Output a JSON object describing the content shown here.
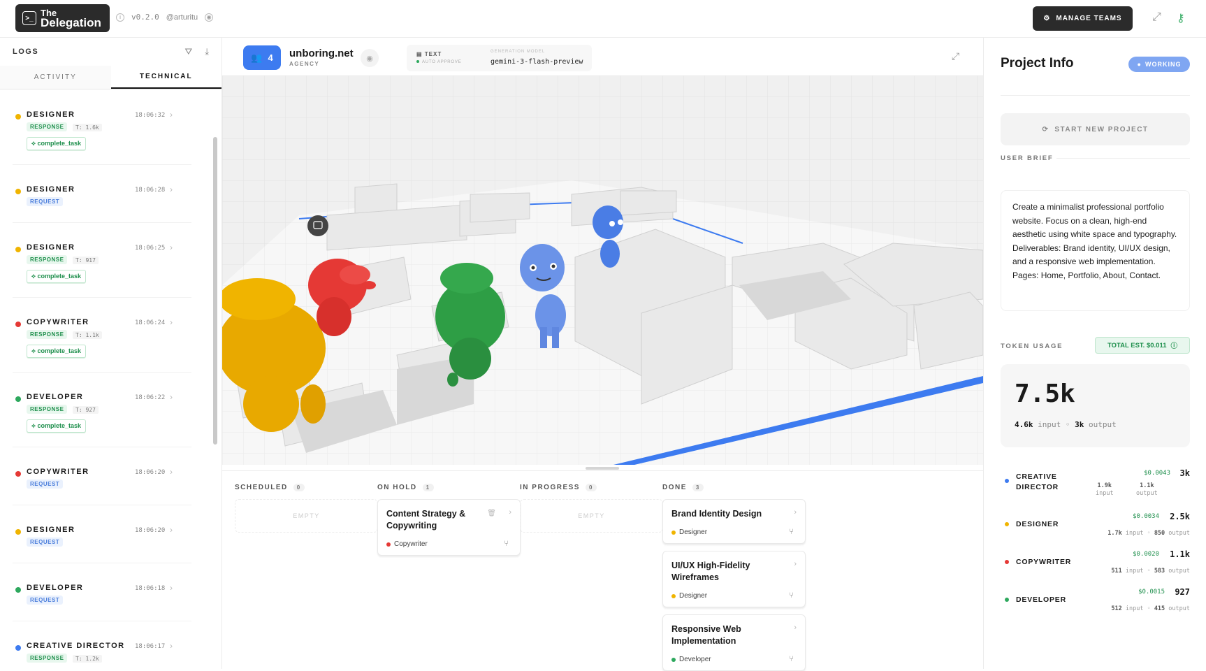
{
  "app": {
    "logo_line1": "The",
    "logo_line2": "Delegation",
    "version": "v0.2.0",
    "author": "@arturitu",
    "manage_teams": "MANAGE TEAMS"
  },
  "logs": {
    "title": "LOGS",
    "tabs": [
      "ACTIVITY",
      "TECHNICAL"
    ],
    "active_tab": "TECHNICAL",
    "items": [
      {
        "role": "DESIGNER",
        "time": "18:06:32",
        "type": "RESPONSE",
        "tokens": "T: 1.6k",
        "tool": "complete_task",
        "color": "#f0b400"
      },
      {
        "role": "DESIGNER",
        "time": "18:06:28",
        "type": "REQUEST",
        "tokens": "",
        "tool": "",
        "color": "#f0b400"
      },
      {
        "role": "DESIGNER",
        "time": "18:06:25",
        "type": "RESPONSE",
        "tokens": "T: 917",
        "tool": "complete_task",
        "color": "#f0b400"
      },
      {
        "role": "COPYWRITER",
        "time": "18:06:24",
        "type": "RESPONSE",
        "tokens": "T: 1.1k",
        "tool": "complete_task",
        "color": "#e53935"
      },
      {
        "role": "DEVELOPER",
        "time": "18:06:22",
        "type": "RESPONSE",
        "tokens": "T: 927",
        "tool": "complete_task",
        "color": "#2da85d"
      },
      {
        "role": "COPYWRITER",
        "time": "18:06:20",
        "type": "REQUEST",
        "tokens": "",
        "tool": "",
        "color": "#e53935"
      },
      {
        "role": "DESIGNER",
        "time": "18:06:20",
        "type": "REQUEST",
        "tokens": "",
        "tool": "",
        "color": "#f0b400"
      },
      {
        "role": "DEVELOPER",
        "time": "18:06:18",
        "type": "REQUEST",
        "tokens": "",
        "tool": "",
        "color": "#2da85d"
      },
      {
        "role": "CREATIVE DIRECTOR",
        "time": "18:06:17",
        "type": "RESPONSE",
        "tokens": "T: 1.2k",
        "tool": "",
        "color": "#3d7bf0"
      }
    ]
  },
  "project": {
    "agent_count": "4",
    "name": "unboring.net",
    "kind": "AGENCY",
    "mode": "TEXT",
    "mode_sub": "AUTO APPROVE",
    "gen_label": "GENERATION MODEL",
    "gen_model": "gemini-3-flash-preview"
  },
  "kanban": {
    "columns": [
      {
        "title": "SCHEDULED",
        "count": "0",
        "empty": "EMPTY",
        "cards": []
      },
      {
        "title": "ON HOLD",
        "count": "1",
        "empty": "",
        "cards": [
          {
            "title": "Content Strategy & Copywriting",
            "assignee": "Copywriter",
            "color": "#e53935"
          }
        ]
      },
      {
        "title": "IN PROGRESS",
        "count": "0",
        "empty": "EMPTY",
        "cards": []
      },
      {
        "title": "DONE",
        "count": "3",
        "empty": "",
        "cards": [
          {
            "title": "Brand Identity Design",
            "assignee": "Designer",
            "color": "#f0b400"
          },
          {
            "title": "UI/UX High-Fidelity Wireframes",
            "assignee": "Designer",
            "color": "#f0b400"
          },
          {
            "title": "Responsive Web Implementation",
            "assignee": "Developer",
            "color": "#2da85d"
          }
        ]
      }
    ]
  },
  "info": {
    "title": "Project Info",
    "status": "WORKING",
    "start_new": "START NEW PROJECT",
    "brief_label": "USER BRIEF",
    "brief": "Create a minimalist professional portfolio website. Focus on a clean, high-end aesthetic using white space and typography. Deliverables: Brand identity, UI/UX design, and a responsive web implementation. Pages: Home, Portfolio, About, Contact.",
    "token_label": "TOKEN USAGE",
    "total_est": "TOTAL EST. $0.011",
    "total_tokens": "7.5k",
    "input_tokens": "4.6k",
    "input_word": "input",
    "output_tokens": "3k",
    "output_word": "output",
    "roles": [
      {
        "name": "CREATIVE DIRECTOR",
        "cost": "$0.0043",
        "total": "3k",
        "input": "1.9k",
        "output": "1.1k",
        "color": "#3d7bf0"
      },
      {
        "name": "DESIGNER",
        "cost": "$0.0034",
        "total": "2.5k",
        "input": "1.7k",
        "output": "850",
        "color": "#f0b400"
      },
      {
        "name": "COPYWRITER",
        "cost": "$0.0020",
        "total": "1.1k",
        "input": "511",
        "output": "583",
        "color": "#e53935"
      },
      {
        "name": "DEVELOPER",
        "cost": "$0.0015",
        "total": "927",
        "input": "512",
        "output": "415",
        "color": "#2da85d"
      }
    ]
  },
  "colors": {
    "accent": "#3d7bf0",
    "green": "#2da85d",
    "yellow": "#f0b400",
    "red": "#e53935"
  }
}
